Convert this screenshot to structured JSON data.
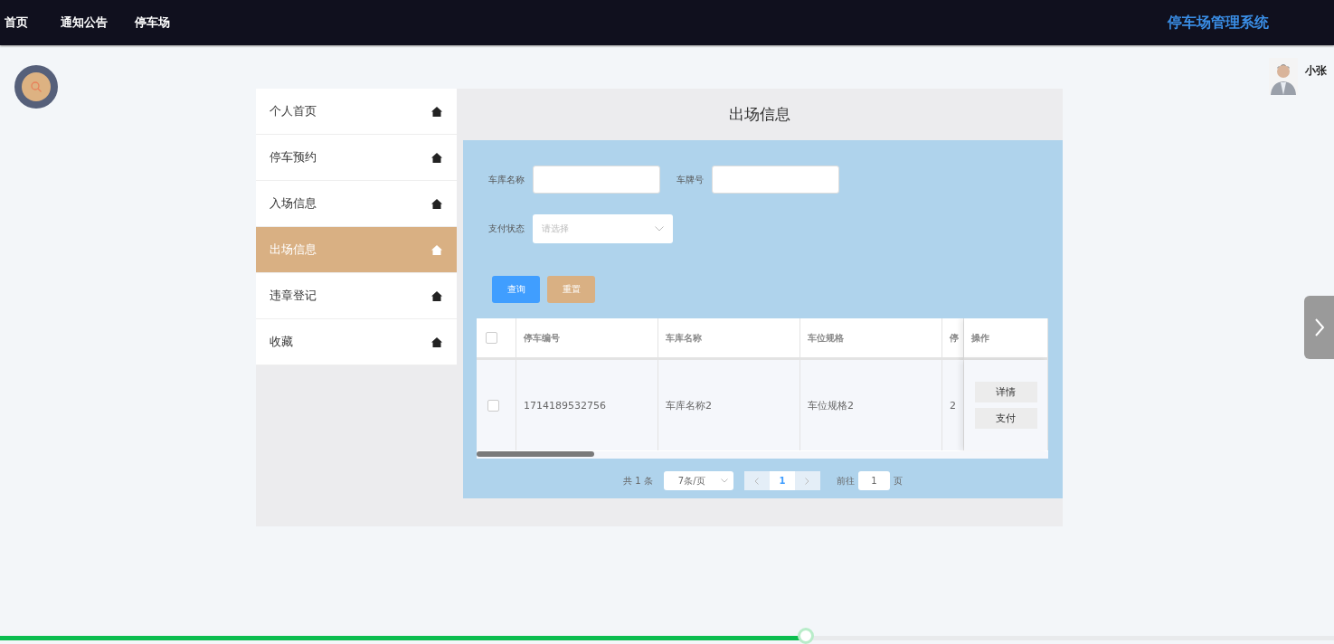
{
  "nav": {
    "items": [
      "首页",
      "通知公告",
      "停车场"
    ],
    "title": "停车场管理系统"
  },
  "user": {
    "name": "小张"
  },
  "sidebar": {
    "items": [
      {
        "label": "个人首页",
        "selected": false
      },
      {
        "label": "停车预约",
        "selected": false
      },
      {
        "label": "入场信息",
        "selected": false
      },
      {
        "label": "出场信息",
        "selected": true
      },
      {
        "label": "违章登记",
        "selected": false
      },
      {
        "label": "收藏",
        "selected": false
      }
    ]
  },
  "page_title": "出场信息",
  "filters": [
    {
      "label": "车库名称",
      "kind": "input"
    },
    {
      "label": "车牌号",
      "kind": "input"
    },
    {
      "label": "支付状态",
      "kind": "select",
      "placeholder": "请选择"
    }
  ],
  "buttons": [
    {
      "label": "查询",
      "kind": "primary"
    },
    {
      "label": "重置",
      "kind": "secondary"
    }
  ],
  "table": {
    "header_checked": false,
    "columns": [
      "停车编号",
      "车库名称",
      "车位规格",
      "停"
    ],
    "action_column": "操作",
    "rows": [
      {
        "checked": false,
        "cells": [
          "1714189532756",
          "车库名称2",
          "车位规格2",
          "2"
        ],
        "actions": [
          "详情",
          "支付"
        ]
      }
    ]
  },
  "pagination": {
    "total": "共 1 条",
    "page_size": "7条/页",
    "pages": [
      {
        "label": "1",
        "selected": true
      }
    ],
    "goto_label": "前往",
    "goto_value": "1",
    "goto_suffix": "页"
  },
  "video_progress": {
    "level": 0.604
  }
}
